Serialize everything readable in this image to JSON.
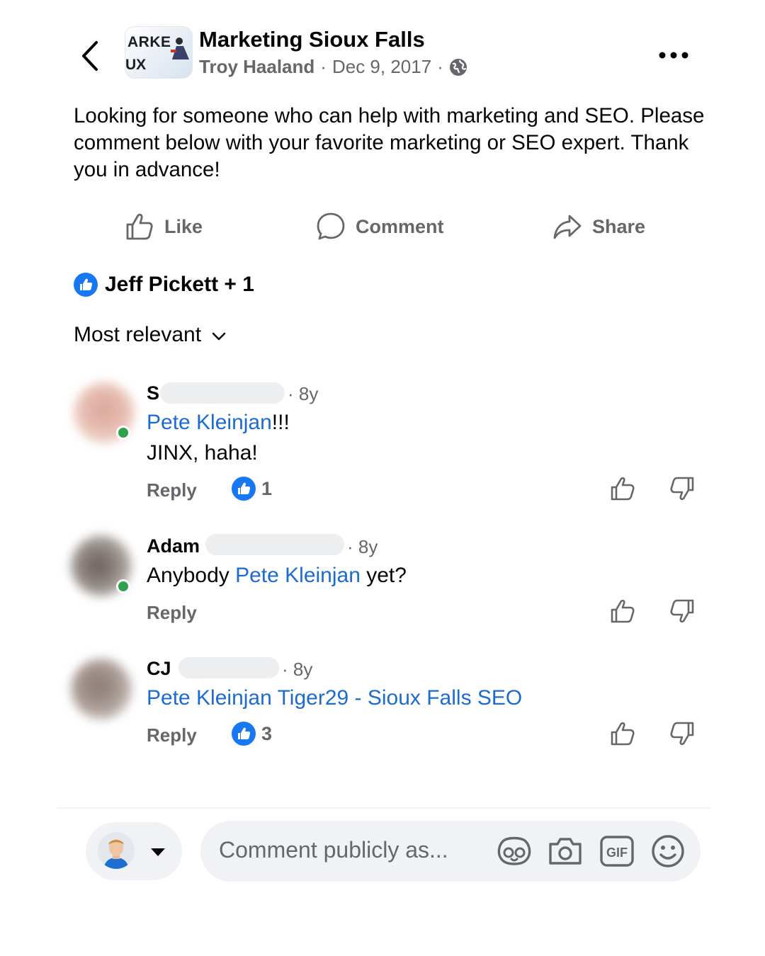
{
  "header": {
    "group_name": "Marketing Sioux Falls",
    "author": "Troy Haaland",
    "separator": "·",
    "date": "Dec 9, 2017",
    "avatar_text_top": "ARKE",
    "avatar_text_bottom": "UX"
  },
  "post": {
    "text": "Looking for someone who can help with marketing and SEO. Please comment below with your favorite marketing or SEO expert. Thank you in advance!"
  },
  "actions": {
    "like": "Like",
    "comment": "Comment",
    "share": "Share"
  },
  "reactions": {
    "summary": "Jeff Pickett + 1"
  },
  "sort": {
    "label": "Most relevant"
  },
  "comments": [
    {
      "name_visible": "S",
      "time": "· 8y",
      "mention": "Pete Kleinjan",
      "text_after_mention": "!!!",
      "line2": "JINX, haha!",
      "reply": "Reply",
      "reaction_count": "1"
    },
    {
      "name_visible": "Adam",
      "time": "· 8y",
      "text_before_mention": "Anybody ",
      "mention": "Pete Kleinjan",
      "text_after_mention": " yet?",
      "reply": "Reply"
    },
    {
      "name_visible": "CJ",
      "time": "· 8y",
      "mention": "Pete Kleinjan Tiger29 - Sioux Falls SEO",
      "reply": "Reply",
      "reaction_count": "3"
    }
  ],
  "composer": {
    "placeholder": "Comment publicly as..."
  },
  "colors": {
    "brand_blue": "#1877f2",
    "mention_blue": "#1c6bd1",
    "secondary_text": "#65676b",
    "online_green": "#31a24c"
  },
  "icons": [
    "back-icon",
    "globe-icon",
    "more-icon",
    "like-icon",
    "comment-icon",
    "share-icon",
    "thumbs-up-badge-icon",
    "chevron-down-icon",
    "upvote-icon",
    "downvote-icon",
    "caret-down-icon",
    "avatar-sticker-icon",
    "camera-icon",
    "gif-icon",
    "emoji-icon"
  ]
}
